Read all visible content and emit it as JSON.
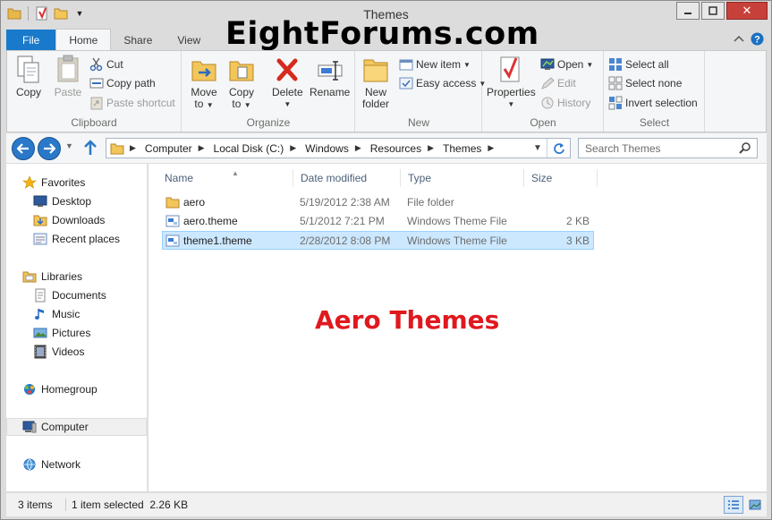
{
  "window": {
    "title": "Themes",
    "watermark": "EightForums.com",
    "overlay_text": "Aero Themes"
  },
  "tabs": [
    {
      "label": "File"
    },
    {
      "label": "Home"
    },
    {
      "label": "Share"
    },
    {
      "label": "View"
    }
  ],
  "ribbon": {
    "clipboard": {
      "label": "Clipboard",
      "copy": "Copy",
      "paste": "Paste",
      "cut": "Cut",
      "copy_path": "Copy path",
      "paste_shortcut": "Paste shortcut"
    },
    "organize": {
      "label": "Organize",
      "move_to_1": "Move",
      "move_to_2": "to",
      "copy_to_1": "Copy",
      "copy_to_2": "to",
      "delete": "Delete",
      "rename": "Rename"
    },
    "new": {
      "label": "New",
      "new_folder_1": "New",
      "new_folder_2": "folder",
      "new_item": "New item",
      "easy_access": "Easy access"
    },
    "open": {
      "label": "Open",
      "properties": "Properties",
      "open": "Open",
      "edit": "Edit",
      "history": "History"
    },
    "select": {
      "label": "Select",
      "select_all": "Select all",
      "select_none": "Select none",
      "invert_selection": "Invert selection"
    }
  },
  "address": {
    "crumbs": [
      "Computer",
      "Local Disk (C:)",
      "Windows",
      "Resources",
      "Themes"
    ],
    "search_placeholder": "Search Themes"
  },
  "nav": {
    "favorites": "Favorites",
    "desktop": "Desktop",
    "downloads": "Downloads",
    "recent_places": "Recent places",
    "libraries": "Libraries",
    "documents": "Documents",
    "music": "Music",
    "pictures": "Pictures",
    "videos": "Videos",
    "homegroup": "Homegroup",
    "computer": "Computer",
    "network": "Network"
  },
  "columns": {
    "name": "Name",
    "date_modified": "Date modified",
    "type": "Type",
    "size": "Size"
  },
  "files": [
    {
      "name": "aero",
      "date": "5/19/2012 2:38 AM",
      "type": "File folder",
      "size": ""
    },
    {
      "name": "aero.theme",
      "date": "5/1/2012 7:21 PM",
      "type": "Windows Theme File",
      "size": "2 KB"
    },
    {
      "name": "theme1.theme",
      "date": "2/28/2012 8:08 PM",
      "type": "Windows Theme File",
      "size": "3 KB"
    }
  ],
  "status": {
    "items": "3 items",
    "selected": "1 item selected  2.26 KB"
  },
  "colors": {
    "accent": "#1979ca",
    "selection": "#cce8ff",
    "overlay_red": "#e0191f"
  }
}
